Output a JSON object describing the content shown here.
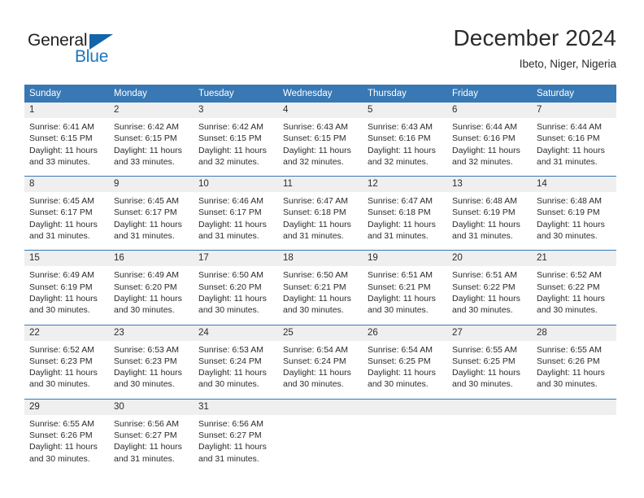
{
  "brand": {
    "name_part1": "General",
    "name_part2": "Blue",
    "triangle_color": "#1464aa",
    "blue_color": "#1b75bb"
  },
  "header": {
    "title": "December 2024",
    "subtitle": "Ibeto, Niger, Nigeria"
  },
  "theme": {
    "header_bg": "#3878b4",
    "daynum_bg": "#efefef",
    "row_rule": "#3878b4",
    "text": "#2b2b2b"
  },
  "calendar": {
    "weekday_headers": [
      "Sunday",
      "Monday",
      "Tuesday",
      "Wednesday",
      "Thursday",
      "Friday",
      "Saturday"
    ],
    "weeks": [
      [
        {
          "day": "1",
          "sunrise": "Sunrise: 6:41 AM",
          "sunset": "Sunset: 6:15 PM",
          "daylight_line1": "Daylight: 11 hours",
          "daylight_line2": "and 33 minutes."
        },
        {
          "day": "2",
          "sunrise": "Sunrise: 6:42 AM",
          "sunset": "Sunset: 6:15 PM",
          "daylight_line1": "Daylight: 11 hours",
          "daylight_line2": "and 33 minutes."
        },
        {
          "day": "3",
          "sunrise": "Sunrise: 6:42 AM",
          "sunset": "Sunset: 6:15 PM",
          "daylight_line1": "Daylight: 11 hours",
          "daylight_line2": "and 32 minutes."
        },
        {
          "day": "4",
          "sunrise": "Sunrise: 6:43 AM",
          "sunset": "Sunset: 6:15 PM",
          "daylight_line1": "Daylight: 11 hours",
          "daylight_line2": "and 32 minutes."
        },
        {
          "day": "5",
          "sunrise": "Sunrise: 6:43 AM",
          "sunset": "Sunset: 6:16 PM",
          "daylight_line1": "Daylight: 11 hours",
          "daylight_line2": "and 32 minutes."
        },
        {
          "day": "6",
          "sunrise": "Sunrise: 6:44 AM",
          "sunset": "Sunset: 6:16 PM",
          "daylight_line1": "Daylight: 11 hours",
          "daylight_line2": "and 32 minutes."
        },
        {
          "day": "7",
          "sunrise": "Sunrise: 6:44 AM",
          "sunset": "Sunset: 6:16 PM",
          "daylight_line1": "Daylight: 11 hours",
          "daylight_line2": "and 31 minutes."
        }
      ],
      [
        {
          "day": "8",
          "sunrise": "Sunrise: 6:45 AM",
          "sunset": "Sunset: 6:17 PM",
          "daylight_line1": "Daylight: 11 hours",
          "daylight_line2": "and 31 minutes."
        },
        {
          "day": "9",
          "sunrise": "Sunrise: 6:45 AM",
          "sunset": "Sunset: 6:17 PM",
          "daylight_line1": "Daylight: 11 hours",
          "daylight_line2": "and 31 minutes."
        },
        {
          "day": "10",
          "sunrise": "Sunrise: 6:46 AM",
          "sunset": "Sunset: 6:17 PM",
          "daylight_line1": "Daylight: 11 hours",
          "daylight_line2": "and 31 minutes."
        },
        {
          "day": "11",
          "sunrise": "Sunrise: 6:47 AM",
          "sunset": "Sunset: 6:18 PM",
          "daylight_line1": "Daylight: 11 hours",
          "daylight_line2": "and 31 minutes."
        },
        {
          "day": "12",
          "sunrise": "Sunrise: 6:47 AM",
          "sunset": "Sunset: 6:18 PM",
          "daylight_line1": "Daylight: 11 hours",
          "daylight_line2": "and 31 minutes."
        },
        {
          "day": "13",
          "sunrise": "Sunrise: 6:48 AM",
          "sunset": "Sunset: 6:19 PM",
          "daylight_line1": "Daylight: 11 hours",
          "daylight_line2": "and 31 minutes."
        },
        {
          "day": "14",
          "sunrise": "Sunrise: 6:48 AM",
          "sunset": "Sunset: 6:19 PM",
          "daylight_line1": "Daylight: 11 hours",
          "daylight_line2": "and 30 minutes."
        }
      ],
      [
        {
          "day": "15",
          "sunrise": "Sunrise: 6:49 AM",
          "sunset": "Sunset: 6:19 PM",
          "daylight_line1": "Daylight: 11 hours",
          "daylight_line2": "and 30 minutes."
        },
        {
          "day": "16",
          "sunrise": "Sunrise: 6:49 AM",
          "sunset": "Sunset: 6:20 PM",
          "daylight_line1": "Daylight: 11 hours",
          "daylight_line2": "and 30 minutes."
        },
        {
          "day": "17",
          "sunrise": "Sunrise: 6:50 AM",
          "sunset": "Sunset: 6:20 PM",
          "daylight_line1": "Daylight: 11 hours",
          "daylight_line2": "and 30 minutes."
        },
        {
          "day": "18",
          "sunrise": "Sunrise: 6:50 AM",
          "sunset": "Sunset: 6:21 PM",
          "daylight_line1": "Daylight: 11 hours",
          "daylight_line2": "and 30 minutes."
        },
        {
          "day": "19",
          "sunrise": "Sunrise: 6:51 AM",
          "sunset": "Sunset: 6:21 PM",
          "daylight_line1": "Daylight: 11 hours",
          "daylight_line2": "and 30 minutes."
        },
        {
          "day": "20",
          "sunrise": "Sunrise: 6:51 AM",
          "sunset": "Sunset: 6:22 PM",
          "daylight_line1": "Daylight: 11 hours",
          "daylight_line2": "and 30 minutes."
        },
        {
          "day": "21",
          "sunrise": "Sunrise: 6:52 AM",
          "sunset": "Sunset: 6:22 PM",
          "daylight_line1": "Daylight: 11 hours",
          "daylight_line2": "and 30 minutes."
        }
      ],
      [
        {
          "day": "22",
          "sunrise": "Sunrise: 6:52 AM",
          "sunset": "Sunset: 6:23 PM",
          "daylight_line1": "Daylight: 11 hours",
          "daylight_line2": "and 30 minutes."
        },
        {
          "day": "23",
          "sunrise": "Sunrise: 6:53 AM",
          "sunset": "Sunset: 6:23 PM",
          "daylight_line1": "Daylight: 11 hours",
          "daylight_line2": "and 30 minutes."
        },
        {
          "day": "24",
          "sunrise": "Sunrise: 6:53 AM",
          "sunset": "Sunset: 6:24 PM",
          "daylight_line1": "Daylight: 11 hours",
          "daylight_line2": "and 30 minutes."
        },
        {
          "day": "25",
          "sunrise": "Sunrise: 6:54 AM",
          "sunset": "Sunset: 6:24 PM",
          "daylight_line1": "Daylight: 11 hours",
          "daylight_line2": "and 30 minutes."
        },
        {
          "day": "26",
          "sunrise": "Sunrise: 6:54 AM",
          "sunset": "Sunset: 6:25 PM",
          "daylight_line1": "Daylight: 11 hours",
          "daylight_line2": "and 30 minutes."
        },
        {
          "day": "27",
          "sunrise": "Sunrise: 6:55 AM",
          "sunset": "Sunset: 6:25 PM",
          "daylight_line1": "Daylight: 11 hours",
          "daylight_line2": "and 30 minutes."
        },
        {
          "day": "28",
          "sunrise": "Sunrise: 6:55 AM",
          "sunset": "Sunset: 6:26 PM",
          "daylight_line1": "Daylight: 11 hours",
          "daylight_line2": "and 30 minutes."
        }
      ],
      [
        {
          "day": "29",
          "sunrise": "Sunrise: 6:55 AM",
          "sunset": "Sunset: 6:26 PM",
          "daylight_line1": "Daylight: 11 hours",
          "daylight_line2": "and 30 minutes."
        },
        {
          "day": "30",
          "sunrise": "Sunrise: 6:56 AM",
          "sunset": "Sunset: 6:27 PM",
          "daylight_line1": "Daylight: 11 hours",
          "daylight_line2": "and 31 minutes."
        },
        {
          "day": "31",
          "sunrise": "Sunrise: 6:56 AM",
          "sunset": "Sunset: 6:27 PM",
          "daylight_line1": "Daylight: 11 hours",
          "daylight_line2": "and 31 minutes."
        },
        {
          "day": "",
          "sunrise": "",
          "sunset": "",
          "daylight_line1": "",
          "daylight_line2": ""
        },
        {
          "day": "",
          "sunrise": "",
          "sunset": "",
          "daylight_line1": "",
          "daylight_line2": ""
        },
        {
          "day": "",
          "sunrise": "",
          "sunset": "",
          "daylight_line1": "",
          "daylight_line2": ""
        },
        {
          "day": "",
          "sunrise": "",
          "sunset": "",
          "daylight_line1": "",
          "daylight_line2": ""
        }
      ]
    ]
  }
}
